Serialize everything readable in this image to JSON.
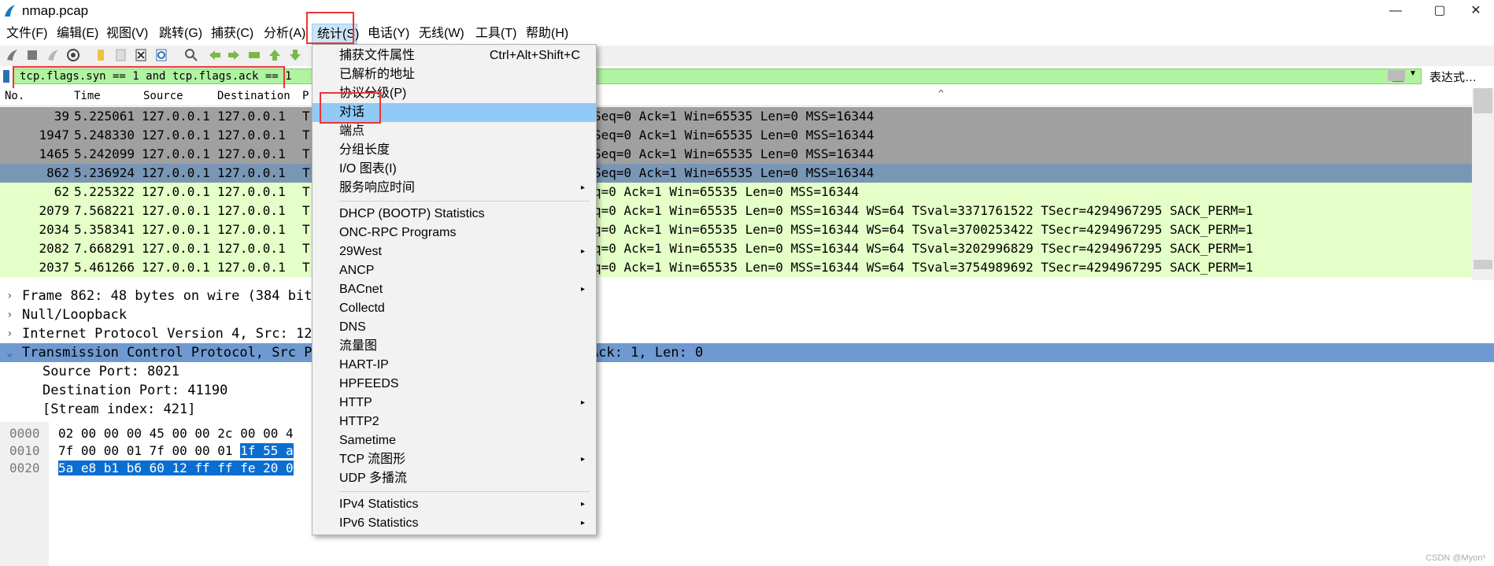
{
  "window": {
    "title": "nmap.pcap",
    "buttons": [
      "—",
      "▢",
      "✕"
    ]
  },
  "menubar": {
    "items": [
      {
        "label": "文件(F)"
      },
      {
        "label": "编辑(E)"
      },
      {
        "label": "视图(V)"
      },
      {
        "label": "跳转(G)"
      },
      {
        "label": "捕获(C)"
      },
      {
        "label": "分析(A)"
      },
      {
        "label": "统计(S)"
      },
      {
        "label": "电话(Y)"
      },
      {
        "label": "无线(W)"
      },
      {
        "label": "工具(T)"
      },
      {
        "label": "帮助(H)"
      }
    ]
  },
  "filter": {
    "value": "tcp.flags.syn == 1 and tcp.flags.ack == 1",
    "expression_label": "表达式…"
  },
  "packet_list": {
    "headers": [
      "No.",
      "Time",
      "Source",
      "Destination",
      "P"
    ],
    "rows": [
      {
        "no": "39",
        "time": "5.225061",
        "src": "127.0.0.1",
        "dst": "127.0.0.1",
        "proto": "T",
        "info": "Seq=0 Ack=1 Win=65535 Len=0 MSS=16344",
        "style": "gray"
      },
      {
        "no": "1947",
        "time": "5.248330",
        "src": "127.0.0.1",
        "dst": "127.0.0.1",
        "proto": "T",
        "info": "Seq=0 Ack=1 Win=65535 Len=0 MSS=16344",
        "style": "gray"
      },
      {
        "no": "1465",
        "time": "5.242099",
        "src": "127.0.0.1",
        "dst": "127.0.0.1",
        "proto": "T",
        "info": "Seq=0 Ack=1 Win=65535 Len=0 MSS=16344",
        "style": "gray"
      },
      {
        "no": "862",
        "time": "5.236924",
        "src": "127.0.0.1",
        "dst": "127.0.0.1",
        "proto": "T",
        "info": "Seq=0 Ack=1 Win=65535 Len=0 MSS=16344",
        "style": "selected"
      },
      {
        "no": "62",
        "time": "5.225322",
        "src": "127.0.0.1",
        "dst": "127.0.0.1",
        "proto": "T",
        "info": "q=0 Ack=1 Win=65535 Len=0 MSS=16344",
        "style": "green"
      },
      {
        "no": "2079",
        "time": "7.568221",
        "src": "127.0.0.1",
        "dst": "127.0.0.1",
        "proto": "T",
        "info": "q=0 Ack=1 Win=65535 Len=0 MSS=16344 WS=64 TSval=3371761522 TSecr=4294967295 SACK_PERM=1",
        "style": "green"
      },
      {
        "no": "2034",
        "time": "5.358341",
        "src": "127.0.0.1",
        "dst": "127.0.0.1",
        "proto": "T",
        "info": "q=0 Ack=1 Win=65535 Len=0 MSS=16344 WS=64 TSval=3700253422 TSecr=4294967295 SACK_PERM=1",
        "style": "green"
      },
      {
        "no": "2082",
        "time": "7.668291",
        "src": "127.0.0.1",
        "dst": "127.0.0.1",
        "proto": "T",
        "info": "q=0 Ack=1 Win=65535 Len=0 MSS=16344 WS=64 TSval=3202996829 TSecr=4294967295 SACK_PERM=1",
        "style": "green"
      },
      {
        "no": "2037",
        "time": "5.461266",
        "src": "127.0.0.1",
        "dst": "127.0.0.1",
        "proto": "T",
        "info": "q=0 Ack=1 Win=65535 Len=0 MSS=16344 WS=64 TSval=3754989692 TSecr=4294967295 SACK_PERM=1",
        "style": "green"
      }
    ]
  },
  "details": {
    "rows": [
      {
        "text": "Frame 862: 48 bytes on wire (384 bits",
        "expanded": false
      },
      {
        "text": "Null/Loopback",
        "expanded": false
      },
      {
        "text": "Internet Protocol Version 4, Src: 127",
        "expanded": false
      },
      {
        "text": "Transmission Control Protocol, Src Po",
        "tail": "Ack: 1, Len: 0",
        "expanded": true
      },
      {
        "text": "Source Port: 8021",
        "child": true
      },
      {
        "text": "Destination Port: 41190",
        "child": true
      },
      {
        "text": "[Stream index: 421]",
        "child": true
      }
    ]
  },
  "bytes": {
    "rows": [
      {
        "offset": "0000",
        "hex": "02 00 00 00 45 00 00 2c  00 00 4",
        "sel": ""
      },
      {
        "offset": "0010",
        "hex": "7f 00 00 01 7f 00 00 01 ",
        "sel": "1f 55 a"
      },
      {
        "offset": "0020",
        "hex": "",
        "sel": "5a e8 b1 b6 60 12 ff ff  fe 20 0"
      }
    ]
  },
  "dropdown": {
    "items": [
      {
        "label": "捕获文件属性",
        "shortcut": "Ctrl+Alt+Shift+C"
      },
      {
        "label": "已解析的地址"
      },
      {
        "label": "协议分级(P)"
      },
      {
        "label": "对话",
        "highlight": true
      },
      {
        "label": "端点"
      },
      {
        "label": "分组长度"
      },
      {
        "label": "I/O 图表(I)"
      },
      {
        "label": "服务响应时间",
        "submenu": true
      },
      {
        "sep": true
      },
      {
        "label": "DHCP (BOOTP) Statistics"
      },
      {
        "label": "ONC-RPC Programs"
      },
      {
        "label": "29West",
        "submenu": true
      },
      {
        "label": "ANCP"
      },
      {
        "label": "BACnet",
        "submenu": true
      },
      {
        "label": "Collectd"
      },
      {
        "label": "DNS"
      },
      {
        "label": "流量图"
      },
      {
        "label": "HART-IP"
      },
      {
        "label": "HPFEEDS"
      },
      {
        "label": "HTTP",
        "submenu": true
      },
      {
        "label": "HTTP2"
      },
      {
        "label": "Sametime"
      },
      {
        "label": "TCP 流图形",
        "submenu": true
      },
      {
        "label": "UDP 多播流"
      },
      {
        "sep": true
      },
      {
        "label": "IPv4 Statistics",
        "submenu": true
      },
      {
        "label": "IPv6 Statistics",
        "submenu": true
      }
    ]
  },
  "colors": {
    "gray_row": "#a0a0a0",
    "selected_row": "#7a96b5",
    "green_row": "#e4ffc7",
    "filter_bg": "#b0f3a0",
    "menu_highlight": "#91c9f7",
    "annotation": "#e33333"
  },
  "watermark": "CSDN @Myon⁵"
}
